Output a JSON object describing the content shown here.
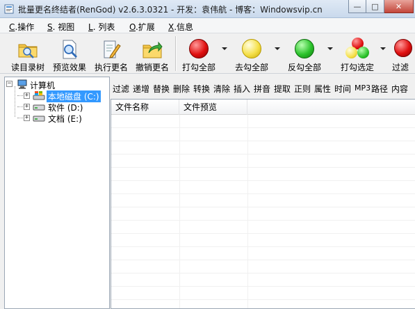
{
  "window": {
    "title": "批量更名终结者(RenGod) v2.6.3.0321 - 开发：袁伟航 - 博客：Windowsvip.cn",
    "minimize_label": "—",
    "maximize_label": "□",
    "close_label": "✕"
  },
  "menu": [
    {
      "key": "C",
      "label": ".操作"
    },
    {
      "key": "S",
      "label": ". 视图"
    },
    {
      "key": "L",
      "label": ". 列表"
    },
    {
      "key": "O",
      "label": ".扩展"
    },
    {
      "key": "X",
      "label": ".信息"
    }
  ],
  "toolbar": {
    "read_dir": "读目录树",
    "preview": "预览效果",
    "execute": "执行更名",
    "undo": "撤销更名",
    "check_all": "打勾全部",
    "uncheck_all": "去勾全部",
    "invert": "反勾全部",
    "check_selected": "打勾选定",
    "filter": "过滤"
  },
  "tree": {
    "root": "计算机",
    "drives": [
      {
        "label": "本地磁盘 (C:)",
        "selected": true
      },
      {
        "label": "软件 (D:)",
        "selected": false
      },
      {
        "label": "文档 (E:)",
        "selected": false
      }
    ]
  },
  "functions": [
    "过滤",
    "递增",
    "替换",
    "删除",
    "转换",
    "清除",
    "插入",
    "拼音",
    "提取",
    "正则",
    "属性",
    "时间",
    "MP3",
    "路径",
    "内容"
  ],
  "filelist": {
    "columns": [
      "文件名称",
      "文件预览"
    ]
  },
  "colors": {
    "selection": "#3399ff",
    "title_bar": "#c9d9ec"
  }
}
